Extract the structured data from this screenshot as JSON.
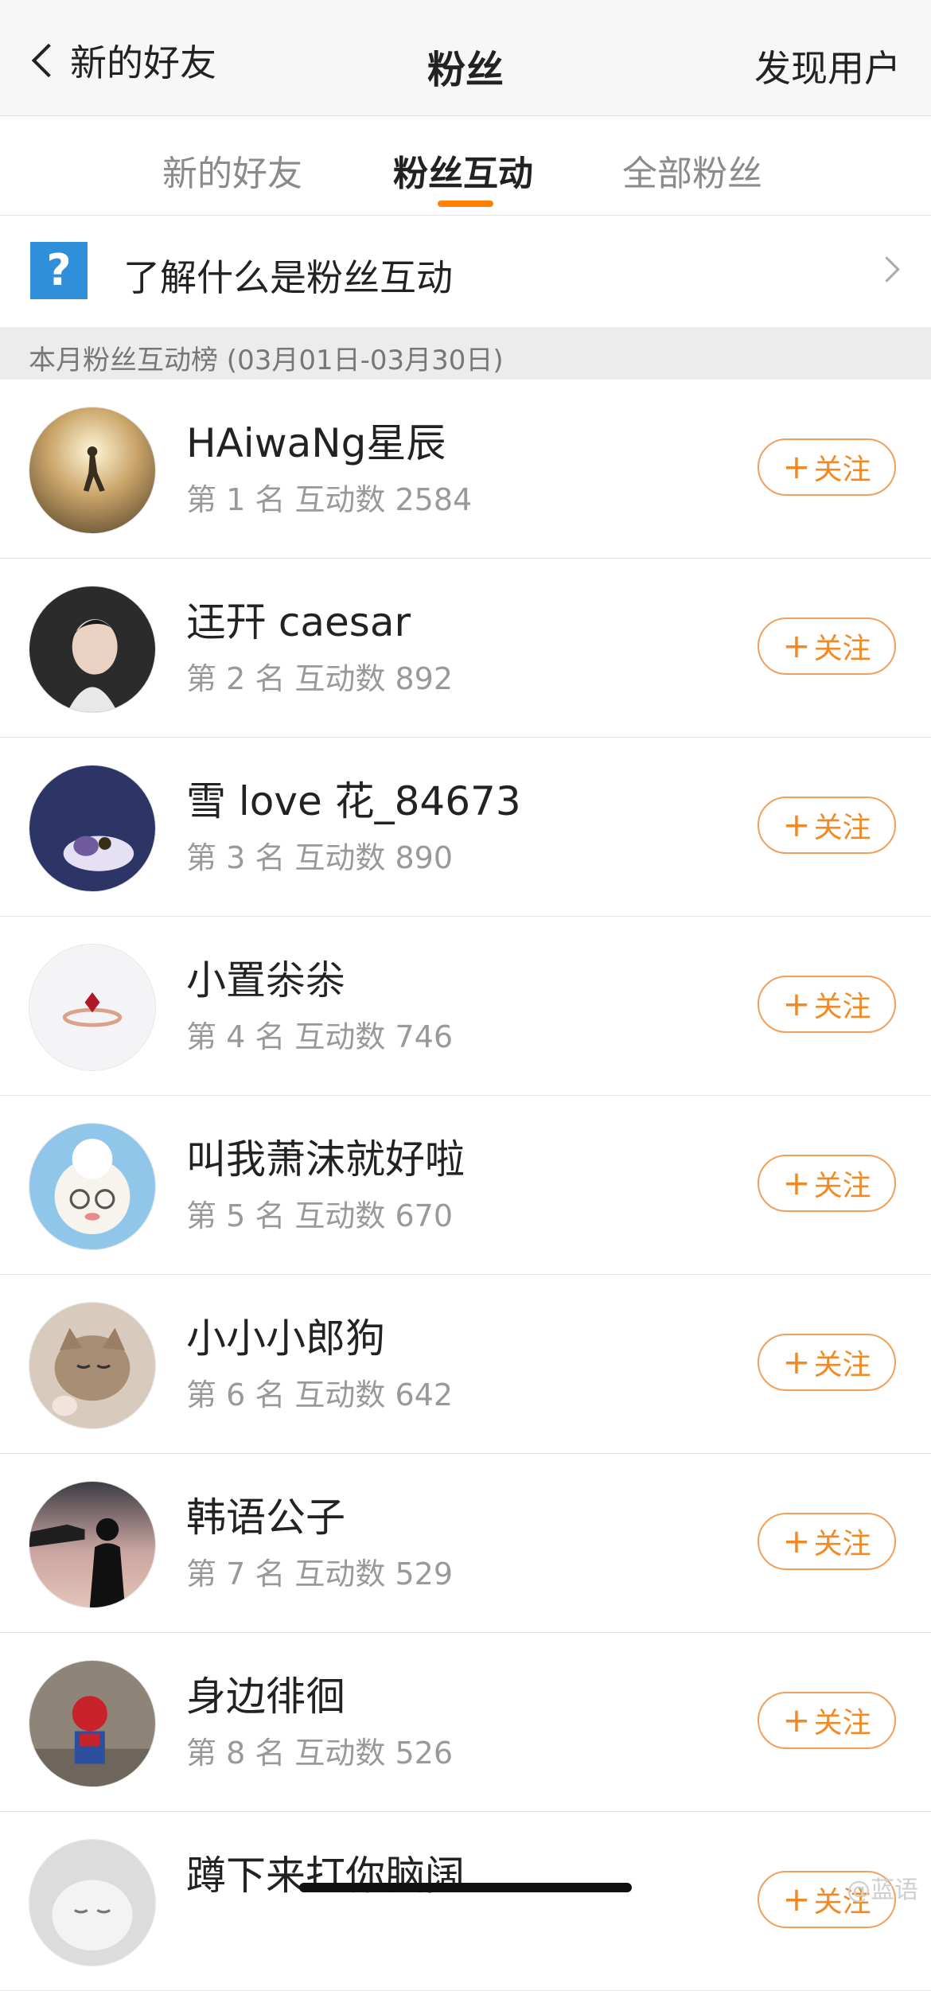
{
  "nav": {
    "back_label": "新的好友",
    "title": "粉丝",
    "right_label": "发现用户"
  },
  "tabs": [
    {
      "label": "新的好友",
      "active": false
    },
    {
      "label": "粉丝互动",
      "active": true
    },
    {
      "label": "全部粉丝",
      "active": false
    }
  ],
  "info": {
    "icon_glyph": "?",
    "text": "了解什么是粉丝互动"
  },
  "section_header": "本月粉丝互动榜 (03月01日-03月30日)",
  "follow_label": "关注",
  "follow_plus": "+",
  "fans": [
    {
      "name": "HAiwaNg星辰",
      "meta": "第 1 名  互动数 2584",
      "avatar": "hero-silhouette-avatar"
    },
    {
      "name": "迋幵 caesar",
      "meta": "第 2 名  互动数 892",
      "avatar": "portrait-avatar"
    },
    {
      "name": "雪 love 花_84673",
      "meta": "第 3 名  互动数 890",
      "avatar": "cartoon-avatar"
    },
    {
      "name": "小置尜尜",
      "meta": "第 4 名  互动数 746",
      "avatar": "ring-avatar"
    },
    {
      "name": "叫我萧沫就好啦",
      "meta": "第 5 名  互动数 670",
      "avatar": "sheep-cartoon-avatar"
    },
    {
      "name": "小小小郎狗",
      "meta": "第 6 名  互动数 642",
      "avatar": "cat-avatar"
    },
    {
      "name": "韩语公子",
      "meta": "第 7 名  互动数 529",
      "avatar": "silhouette-avatar"
    },
    {
      "name": "身边徘徊",
      "meta": "第 8 名  互动数 526",
      "avatar": "spiderman-avatar"
    },
    {
      "name": "蹲下来打你脑阔",
      "meta": "",
      "avatar": "white-cat-avatar"
    }
  ],
  "watermark": "@蓝语",
  "colors": {
    "accent": "#ff8200",
    "follow_text": "#f28a24",
    "info_icon": "#2f8fd8"
  }
}
